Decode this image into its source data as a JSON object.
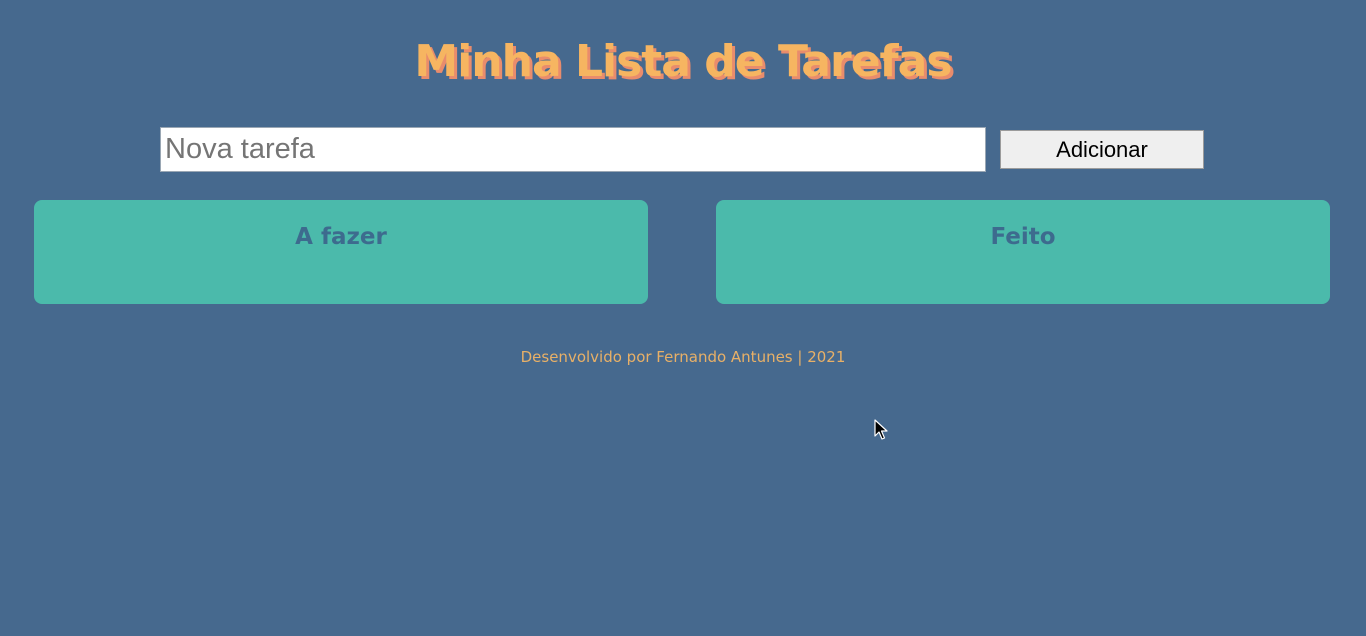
{
  "header": {
    "title": "Minha Lista de Tarefas"
  },
  "form": {
    "input_placeholder": "Nova tarefa",
    "input_value": "",
    "add_button_label": "Adicionar"
  },
  "columns": [
    {
      "title": "A fazer",
      "items": []
    },
    {
      "title": "Feito",
      "items": []
    }
  ],
  "footer": {
    "text": "Desenvolvido por Fernando Antunes | 2021"
  },
  "colors": {
    "background": "#46698e",
    "title": "#f6b561",
    "title_shadow": "#e98c6c",
    "column_bg": "#4bbaab",
    "column_title": "#3d6b8e",
    "footer_text": "#e8b067"
  },
  "cursor": {
    "icon": "mouse-pointer-icon"
  }
}
